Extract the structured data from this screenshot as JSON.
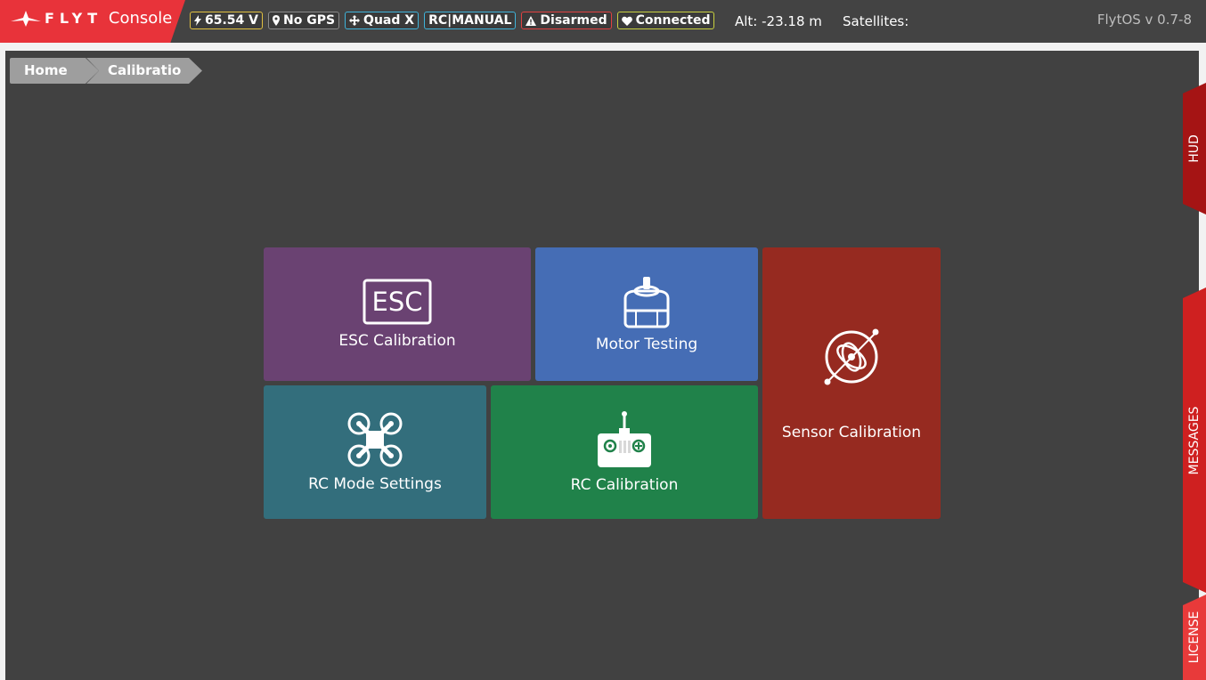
{
  "header": {
    "logo_brand": "FLYT",
    "logo_product": "Console",
    "badges": {
      "voltage": "65.54 V",
      "gps": "No GPS",
      "frame": "Quad X",
      "mode": "RC|MANUAL",
      "arm_state": "Disarmed",
      "connection": "Connected"
    },
    "altitude": "Alt: -23.18 m",
    "satellites": "Satellites:",
    "version": "FlytOS v 0.7-8"
  },
  "breadcrumb": {
    "home": "Home",
    "current": "Calibratio"
  },
  "tiles": {
    "esc": {
      "icon_text": "ESC",
      "label": "ESC Calibration",
      "color": "#6a4272"
    },
    "motor": {
      "label": "Motor Testing",
      "color": "#456db5"
    },
    "sensor": {
      "label": "Sensor Calibration",
      "color": "#962a20"
    },
    "rc_mode": {
      "label": "RC Mode Settings",
      "color": "#336e7c"
    },
    "rc_cal": {
      "label": "RC Calibration",
      "color": "#20824a"
    }
  },
  "side_tabs": {
    "hud": "HUD",
    "messages": "MESSAGES",
    "license": "LICENSE"
  },
  "colors": {
    "brand": "#e8333a",
    "topbar": "#434343",
    "panel": "#414141"
  }
}
